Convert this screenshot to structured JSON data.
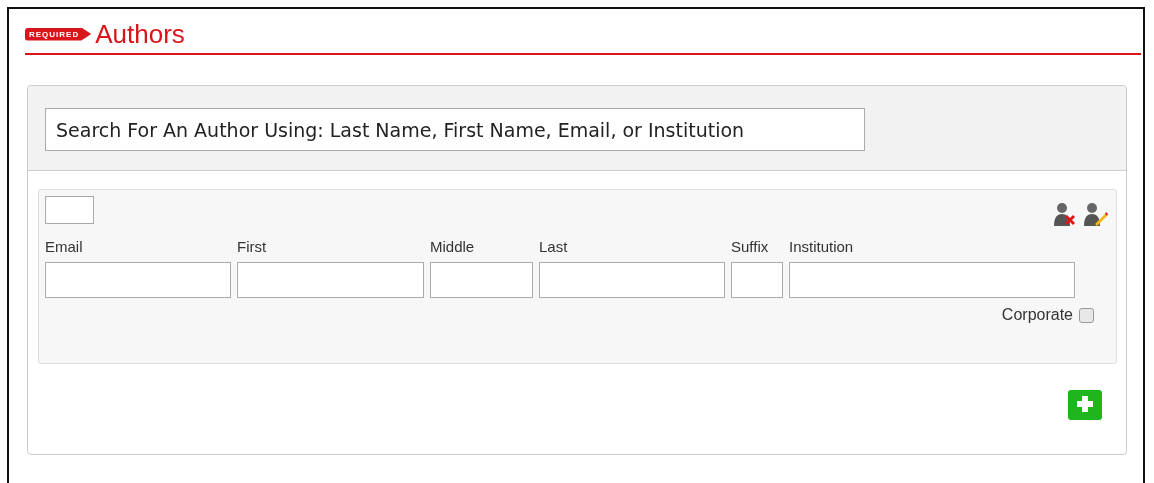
{
  "section": {
    "badge": "REQUIRED",
    "title": "Authors"
  },
  "search": {
    "placeholder": "Search For An Author Using: Last Name, First Name, Email, or Institution"
  },
  "author": {
    "fields": [
      {
        "label": "Email"
      },
      {
        "label": "First"
      },
      {
        "label": "Middle"
      },
      {
        "label": "Last"
      },
      {
        "label": "Suffix"
      },
      {
        "label": "Institution"
      }
    ],
    "corporate": {
      "label": "Corporate",
      "checked": false
    }
  }
}
